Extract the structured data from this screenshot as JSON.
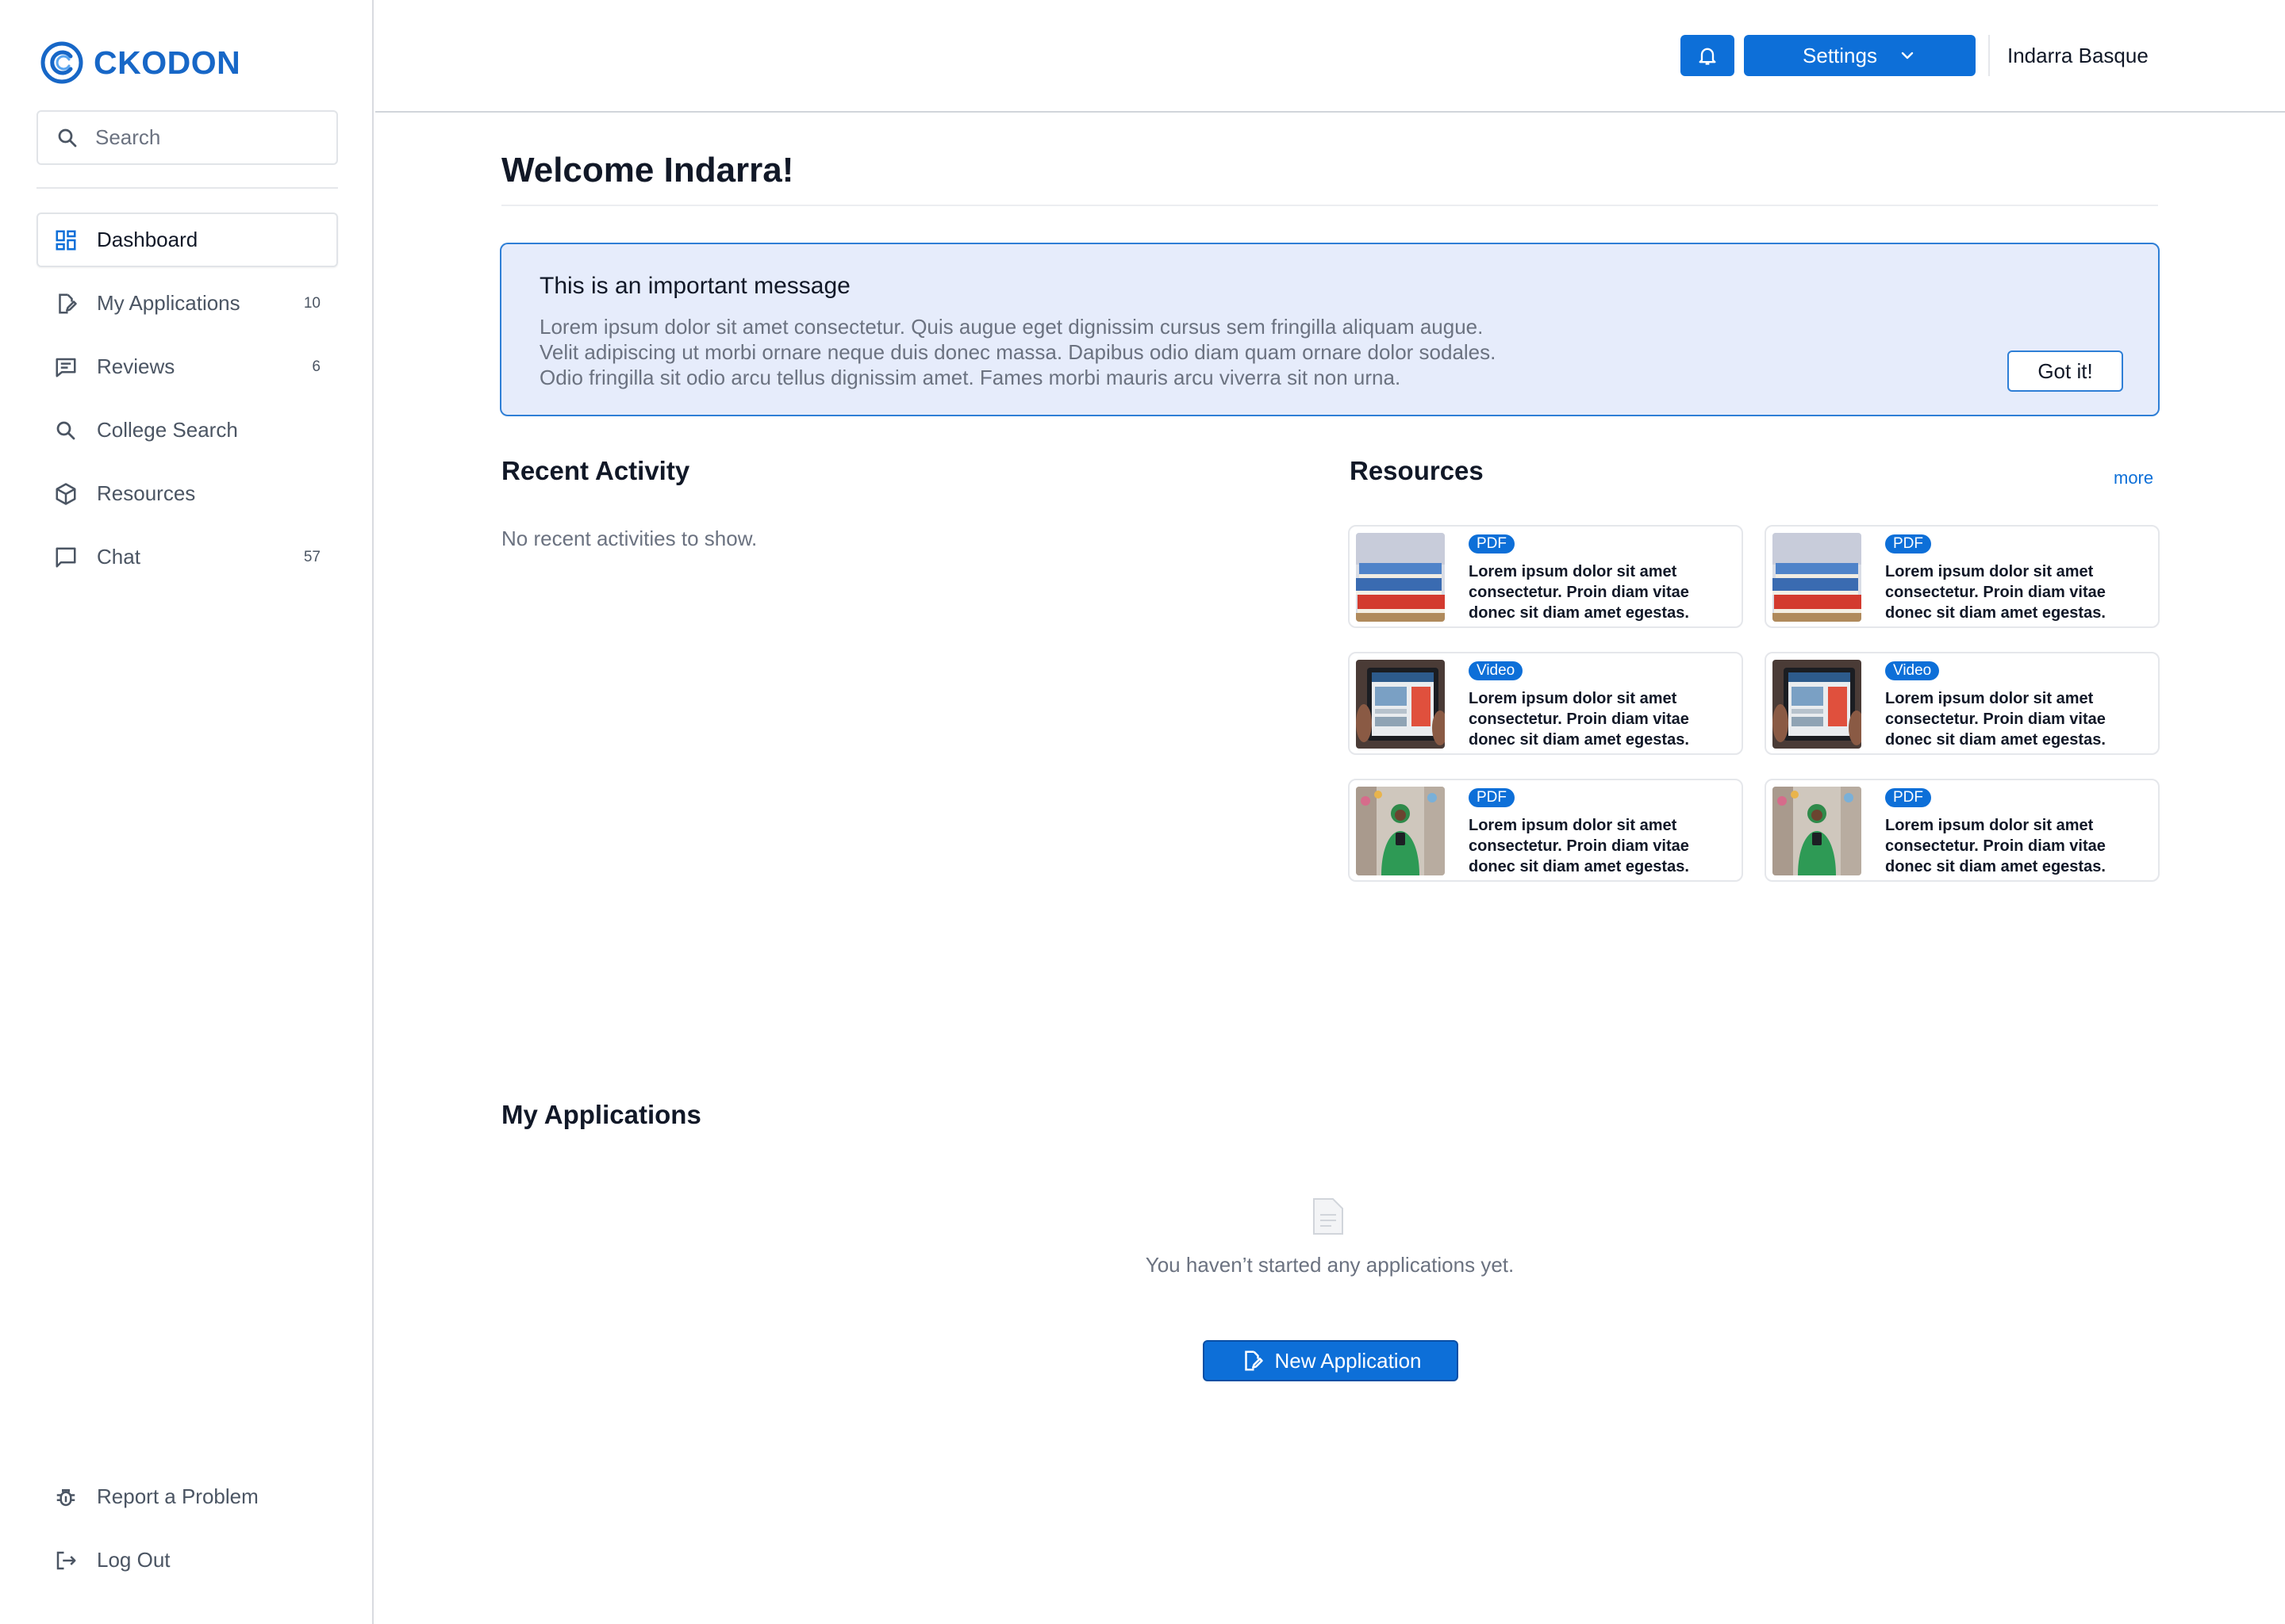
{
  "brand": {
    "name": "CKODON",
    "accent": "#0d6fd8"
  },
  "search": {
    "placeholder": "Search"
  },
  "sidebar": {
    "items": [
      {
        "label": "Dashboard",
        "icon": "dashboard-icon",
        "count": "",
        "active": true
      },
      {
        "label": "My Applications",
        "icon": "edit-document-icon",
        "count": "10"
      },
      {
        "label": "Reviews",
        "icon": "reviews-icon",
        "count": "6"
      },
      {
        "label": "College Search",
        "icon": "search-icon",
        "count": ""
      },
      {
        "label": "Resources",
        "icon": "package-icon",
        "count": ""
      },
      {
        "label": "Chat",
        "icon": "chat-icon",
        "count": "57"
      }
    ],
    "bottom": [
      {
        "label": "Report a Problem",
        "icon": "bug-icon"
      },
      {
        "label": "Log Out",
        "icon": "logout-icon"
      }
    ]
  },
  "header": {
    "settings_label": "Settings",
    "user_name": "Indarra Basque"
  },
  "main": {
    "welcome": "Welcome Indarra!",
    "alert": {
      "title": "This is an important message",
      "lines": [
        "Lorem ipsum dolor sit amet consectetur. Quis augue eget dignissim cursus sem fringilla aliquam augue.",
        "Velit adipiscing ut morbi ornare neque duis donec massa. Dapibus odio diam quam ornare dolor sodales.",
        "Odio fringilla sit odio arcu tellus dignissim amet. Fames morbi mauris arcu viverra sit non urna."
      ],
      "button": "Got it!"
    },
    "recent_activity": {
      "title": "Recent Activity",
      "empty": "No recent activities to show."
    },
    "resources": {
      "title": "Resources",
      "more": "more",
      "items": [
        {
          "badge": "PDF",
          "thumb": "books-image",
          "text": "Lorem ipsum dolor sit amet consectetur. Proin diam vitae donec sit diam amet egestas."
        },
        {
          "badge": "PDF",
          "thumb": "books-image",
          "text": "Lorem ipsum dolor sit amet consectetur. Proin diam vitae donec sit diam amet egestas."
        },
        {
          "badge": "Video",
          "thumb": "tablet-image",
          "text": "Lorem ipsum dolor sit amet consectetur. Proin diam vitae donec sit diam amet egestas."
        },
        {
          "badge": "Video",
          "thumb": "tablet-image",
          "text": "Lorem ipsum dolor sit amet consectetur. Proin diam vitae donec sit diam amet egestas."
        },
        {
          "badge": "PDF",
          "thumb": "person-image",
          "text": "Lorem ipsum dolor sit amet consectetur. Proin diam vitae donec sit diam amet egestas."
        },
        {
          "badge": "PDF",
          "thumb": "person-image",
          "text": "Lorem ipsum dolor sit amet consectetur. Proin diam vitae donec sit diam amet egestas."
        }
      ]
    },
    "applications": {
      "title": "My Applications",
      "empty": "You haven’t started any applications yet.",
      "button": "New Application"
    }
  }
}
